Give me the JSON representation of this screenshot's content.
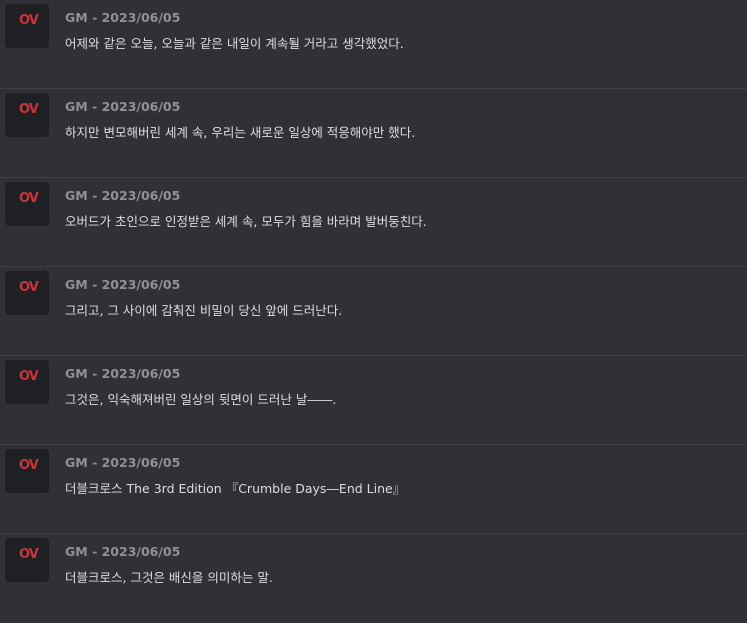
{
  "avatar": {
    "logo_text": "OV"
  },
  "messages": [
    {
      "author": "GM",
      "date": "2023/06/05",
      "text": "어제와 같은 오늘, 오늘과 같은 내일이 계속될 거라고 생각했었다."
    },
    {
      "author": "GM",
      "date": "2023/06/05",
      "text": "하지만 변모해버린 세계 속, 우리는 새로운 일상에 적응해야만 했다."
    },
    {
      "author": "GM",
      "date": "2023/06/05",
      "text": "오버드가 초인으로 인정받은 세계 속, 모두가 힘을 바라며 발버둥친다."
    },
    {
      "author": "GM",
      "date": "2023/06/05",
      "text": "그리고, 그 사이에 감춰진 비밀이 당신 앞에 드러난다."
    },
    {
      "author": "GM",
      "date": "2023/06/05",
      "text": "그것은, 익숙해져버린 일상의 뒷면이 드러난 날――."
    },
    {
      "author": "GM",
      "date": "2023/06/05",
      "text": "더블크로스 The 3rd Edition 『Crumble Days―End Line』"
    },
    {
      "author": "GM",
      "date": "2023/06/05",
      "text": "더블크로스, 그것은 배신을 의미하는 말."
    }
  ]
}
